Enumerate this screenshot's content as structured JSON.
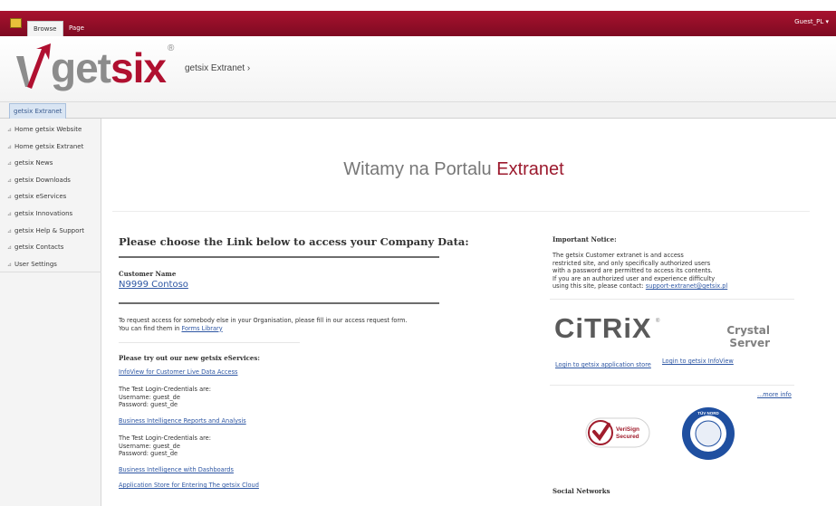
{
  "ribbon": {
    "tabs": [
      "Browse",
      "Page"
    ],
    "user": "Guest_PL ▾"
  },
  "header": {
    "logo_get": "get",
    "logo_six": "six",
    "logo_reg": "®",
    "site_title": "getsix Extranet ›"
  },
  "site_tab": "getsix Extranet",
  "nav": {
    "items": [
      "Home getsix Website",
      "Home getsix Extranet",
      "getsix News",
      "getsix Downloads",
      "getsix eServices",
      "getsix Innovations",
      "getsix Help & Support",
      "getsix Contacts",
      "User Settings"
    ]
  },
  "welcome": {
    "prefix": "Witamy na Portalu ",
    "highlight": "Extranet"
  },
  "main": {
    "heading": "Please choose the Link below to access your Company Data:",
    "customer_label": "Customer Name",
    "customer_link": "N9999 Contoso",
    "request_line1": "To request access for somebody else in your Organisation, please fill in our access request form.",
    "request_line2_prefix": "You can find them in ",
    "request_link": "Forms Library",
    "eservices_title": "Please try out our new getsix eServices:",
    "link_infoview": "InfoView for Customer Live Data Access",
    "creds1": [
      "The Test Login-Credentials are:",
      "Username: guest_de",
      "Password:  guest_de"
    ],
    "link_bi": "Business Intelligence Reports and Analysis",
    "creds2": [
      "The Test Login-Credentials are:",
      "Username: guest_de",
      "Password:  guest_de"
    ],
    "link_dash": "Business Intelligence with Dashboards",
    "link_cloud": "Application Store for Entering The getsix Cloud"
  },
  "notice": {
    "title": "Important Notice:",
    "lines": [
      "The getsix Customer extranet is and access",
      "restricted site, and only specifically authorized users",
      "with a password are permitted to access its contents.",
      "If you are an authorized user and experience difficulty"
    ],
    "last_prefix": "using this site, please contact: ",
    "email": "support-extranet@getsix.pl"
  },
  "logos": {
    "citrix": "CiTRiX",
    "citrix_reg": "®",
    "crystal_1": "Crystal",
    "crystal_2": "Server",
    "link_app_store": "Login to getsix application store",
    "link_infoview": "Login to getsix InfoView",
    "more_info": "...more info",
    "verisign_1": "VeriSign",
    "verisign_2": "Secured",
    "tuv_1": "TÜV NORD"
  },
  "social_title": "Social Networks",
  "colors": {
    "ribbon": "#8e0d27",
    "brand_red": "#b01030",
    "link": "#2d56a3"
  }
}
